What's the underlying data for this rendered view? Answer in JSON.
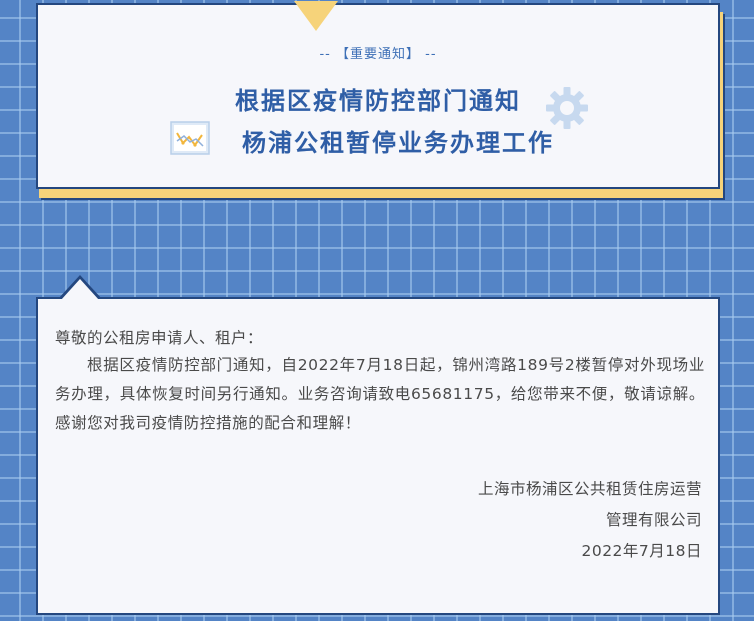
{
  "header": {
    "tag": "-- 【重要通知】 --",
    "title_line_1": "根据区疫情防控部门通知",
    "title_line_2": "杨浦公租暂停业务办理工作"
  },
  "icons": {
    "chart": "line-chart-icon",
    "gear": "gear-icon"
  },
  "body": {
    "greeting": "尊敬的公租房申请人、租户：",
    "paragraph": "根据区疫情防控部门通知，自2022年7月18日起，锦州湾路189号2楼暂停对外现场业务办理，具体恢复时间另行通知。业务咨询请致电65681175，给您带来不便，敬请谅解。感谢您对我司疫情防控措施的配合和理解！",
    "signature_line_1": "上海市杨浦区公共租赁住房运营",
    "signature_line_2": "管理有限公司",
    "date": "2022年7月18日"
  },
  "colors": {
    "background": "#5484c6",
    "title": "#2f5ea6",
    "accent_yellow": "#f6d37a",
    "border": "#24477f",
    "card": "#f6f7fb"
  }
}
